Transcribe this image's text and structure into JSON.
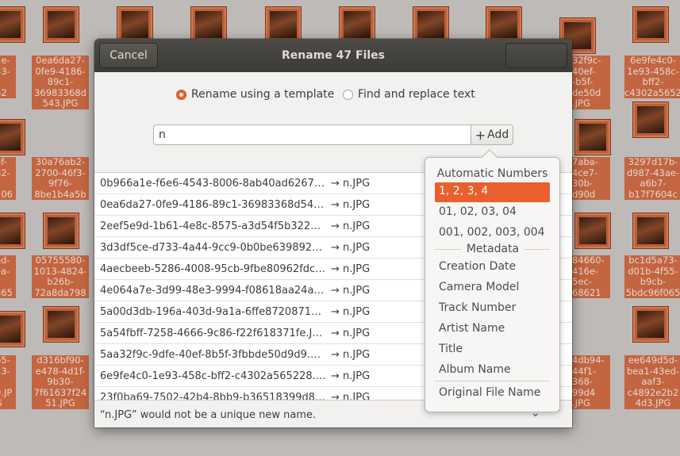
{
  "background": {
    "files": [
      {
        "id": "f1",
        "text": "1e-\n43-\n-\n62"
      },
      {
        "id": "f2",
        "text": "0ea6da27-\n0fe9-4186-\n89c1-\n36983368d\n543.JPG"
      },
      {
        "id": "f3",
        "text": "32f9c-\n40ef-\n-b5f-\nde50d\n.JPG"
      },
      {
        "id": "f4",
        "text": "6e9fe4c0-\n1e93-458c-\nbff2-\nc4302a5652"
      },
      {
        "id": "f5",
        "text": "ef-\n82-\n-\n706"
      },
      {
        "id": "f6",
        "text": "30a76ab2-\n2700-46f3-\n9f76-\n8be1b4a5b"
      },
      {
        "id": "f7",
        "text": "7aba-\n4ce7-\n30b-\nd90d"
      },
      {
        "id": "f8",
        "text": "3297d17b-\nd987-43ae-\na6b7-\nb17f7604c"
      },
      {
        "id": "f9",
        "text": "ed-\nea-\n-\n865"
      },
      {
        "id": "f10",
        "text": "05755580-\n1013-4824-\nb26b-\n72a8da798"
      },
      {
        "id": "f11",
        "text": "84660-\n416e-\n5ec-\n68621"
      },
      {
        "id": "f12",
        "text": "bc1d5a73-\nd01b-4f55-\nb9cb-\n5bdc96f065"
      },
      {
        "id": "f13",
        "text": "b5-\n23-\n-\n0.JPG"
      },
      {
        "id": "f14",
        "text": "d316bf90-\ne478-4d1f-\n9b30-\n7f61637f24\n51.JPG"
      },
      {
        "id": "f15",
        "text": "4db94-\n44f1-\n368-\n99d4\n.JPG"
      },
      {
        "id": "f16",
        "text": "ee649d5d-\nbea1-43ed-\naaf3-\nc4892e2b2\n4d3.JPG"
      }
    ]
  },
  "dialog": {
    "title": "Rename 47 Files",
    "cancel_label": "Cancel",
    "radio_template_label": "Rename using a template",
    "radio_replace_label": "Find and replace text",
    "template_value": "n",
    "add_label": "Add",
    "status_text": "“n.JPG” would not be a unique new name.",
    "rows": [
      {
        "original": "0b966a1e-f6e6-4543-8006-8ab40ad6267…",
        "new": "→ n.JPG"
      },
      {
        "original": "0ea6da27-0fe9-4186-89c1-36983368d54…",
        "new": "→ n.JPG"
      },
      {
        "original": "2eef5e9d-1b61-4e8c-8575-a3d54f5b322…",
        "new": "→ n.JPG"
      },
      {
        "original": "3d3df5ce-d733-4a44-9cc9-0b0be639892…",
        "new": "→ n.JPG"
      },
      {
        "original": "4aecbeeb-5286-4008-95cb-9fbe80962fdc…",
        "new": "→ n.JPG"
      },
      {
        "original": "4e064a7e-3d99-48e3-9994-f08618aa24a…",
        "new": "→ n.JPG"
      },
      {
        "original": "5a00d3db-196a-403d-9a1a-6ffe8720871…",
        "new": "→ n.JPG"
      },
      {
        "original": "5a54fbff-7258-4666-9c86-f22f618371fe.J…",
        "new": "→ n.JPG"
      },
      {
        "original": "5aa32f9c-9dfe-40ef-8b5f-3fbbde50d9d9.…",
        "new": "→ n.JPG"
      },
      {
        "original": "6e9fe4c0-1e93-458c-bff2-c4302a565228.…",
        "new": "→ n.JPG"
      },
      {
        "original": "23f0ba69-7502-42b4-8bb9-b36518399d8…",
        "new": "→ n.JPG"
      }
    ]
  },
  "popover": {
    "automatic_header": "Automatic Numbers",
    "number_options": [
      "1, 2, 3, 4",
      "01, 02, 03, 04",
      "001, 002, 003, 004"
    ],
    "metadata_header": "Metadata",
    "metadata_options": [
      "Creation Date",
      "Camera Model",
      "Track Number",
      "Artist Name",
      "Title",
      "Album Name"
    ],
    "original_label": "Original File Name"
  },
  "colors": {
    "accent": "#e95f2e",
    "titlebar": "#3c3b37",
    "selection_bg": "#d06c46"
  }
}
